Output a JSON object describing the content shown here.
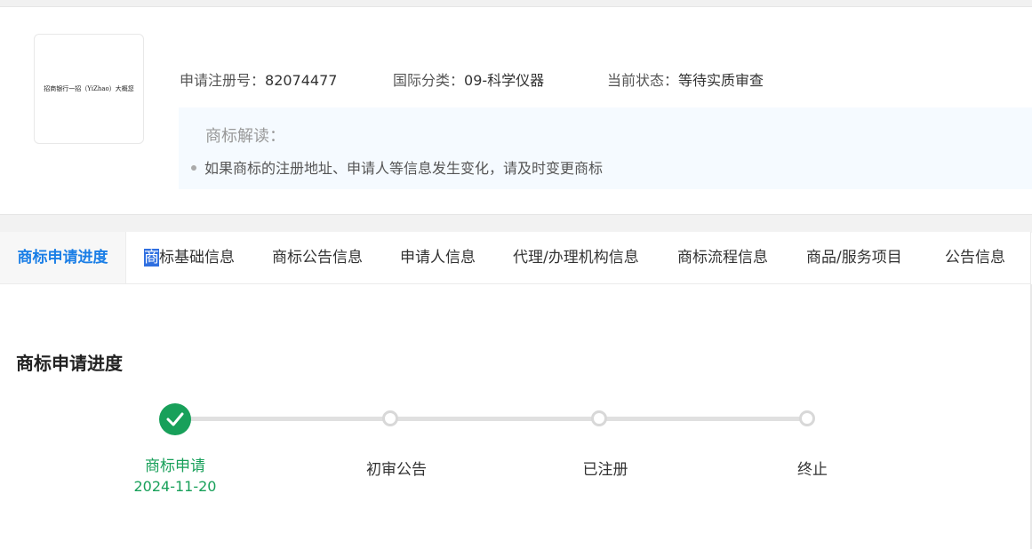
{
  "logo": {
    "text": "招商银行一招（YiZhao）大概您"
  },
  "info": {
    "reg_no_label": "申请注册号：",
    "reg_no": "82074477",
    "class_label": "国际分类：",
    "class_value": "09-科学仪器",
    "status_label": "当前状态：",
    "status_value": "等待实质审查"
  },
  "interpretation": {
    "title": "商标解读：",
    "items": [
      "如果商标的注册地址、申请人等信息发生变化，请及时变更商标"
    ]
  },
  "tabs": [
    {
      "label": "商标申请进度",
      "active": true
    },
    {
      "label_first": "商",
      "label_rest": "标基础信息"
    },
    {
      "label": "商标公告信息"
    },
    {
      "label": "申请人信息"
    },
    {
      "label": "代理/办理机构信息"
    },
    {
      "label": "商标流程信息"
    },
    {
      "label": "商品/服务项目"
    },
    {
      "label": "公告信息"
    }
  ],
  "progress": {
    "title": "商标申请进度",
    "steps": [
      {
        "label": "商标申请",
        "date": "2024-11-20",
        "status": "done"
      },
      {
        "label": "初审公告",
        "status": "pending"
      },
      {
        "label": "已注册",
        "status": "pending"
      },
      {
        "label": "终止",
        "status": "pending"
      }
    ]
  },
  "colors": {
    "accent": "#1a7ee6",
    "success": "#18a05a",
    "highlight": "#2f6fe0"
  }
}
